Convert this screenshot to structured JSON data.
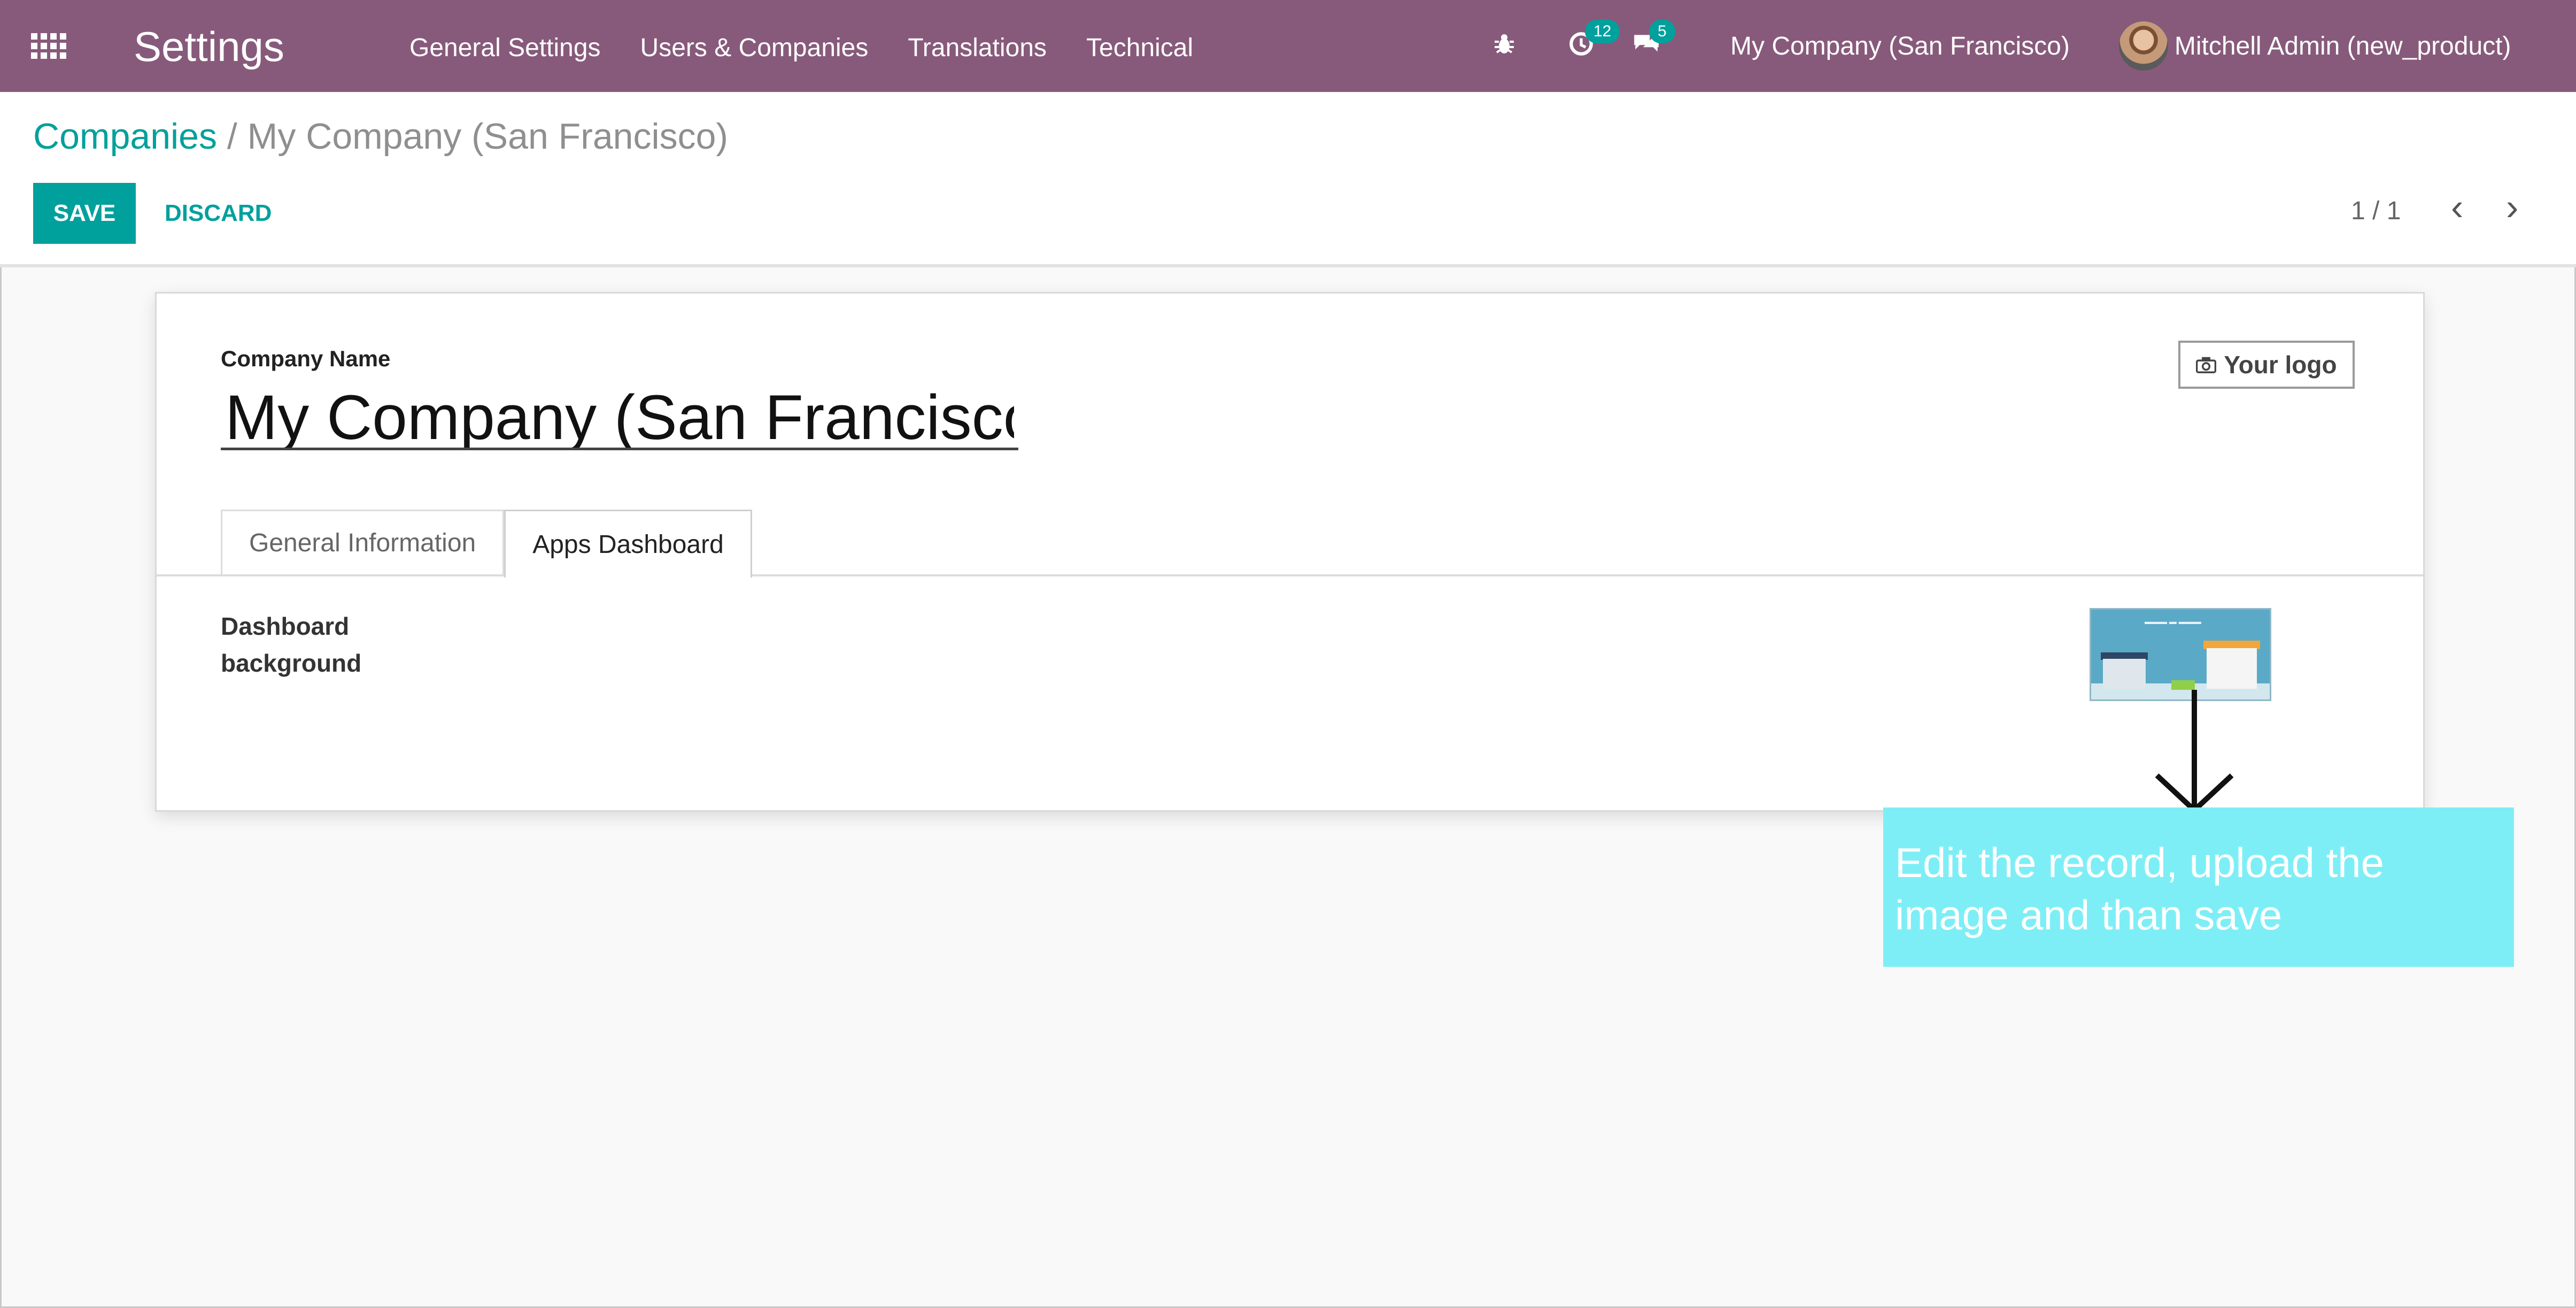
{
  "navbar": {
    "app_title": "Settings",
    "menu_items": [
      "General Settings",
      "Users & Companies",
      "Translations",
      "Technical"
    ],
    "activity_count": "12",
    "message_count": "5",
    "company_switcher": "My Company (San Francisco)",
    "user_name": "Mitchell Admin (new_product)"
  },
  "breadcrumb": {
    "parent": "Companies",
    "separator": "/",
    "current": "My Company (San Francisco)"
  },
  "actions": {
    "save_label": "SAVE",
    "discard_label": "DISCARD"
  },
  "pager": {
    "text": "1 / 1"
  },
  "form": {
    "company_name_label": "Company Name",
    "company_name_value": "My Company (San Francisco)",
    "logo_button_label": "Your logo",
    "tabs": [
      {
        "label": "General Information",
        "active": false
      },
      {
        "label": "Apps Dashboard",
        "active": true
      }
    ],
    "dashboard_background_label": "Dashboard background"
  },
  "annotation": {
    "text": "Edit the record, upload the image and than save"
  },
  "colors": {
    "navbar": "#875a7b",
    "accent": "#00a09d",
    "callout": "#7eeef6"
  }
}
